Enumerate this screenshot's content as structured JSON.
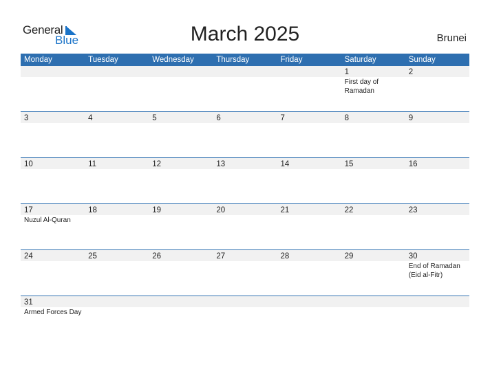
{
  "brand": {
    "line1": "General",
    "line2": "Blue"
  },
  "title": "March 2025",
  "country": "Brunei",
  "weekdays": [
    "Monday",
    "Tuesday",
    "Wednesday",
    "Thursday",
    "Friday",
    "Saturday",
    "Sunday"
  ],
  "weeks": [
    [
      {
        "day": "",
        "event": ""
      },
      {
        "day": "",
        "event": ""
      },
      {
        "day": "",
        "event": ""
      },
      {
        "day": "",
        "event": ""
      },
      {
        "day": "",
        "event": ""
      },
      {
        "day": "1",
        "event": "First day of Ramadan"
      },
      {
        "day": "2",
        "event": ""
      }
    ],
    [
      {
        "day": "3",
        "event": ""
      },
      {
        "day": "4",
        "event": ""
      },
      {
        "day": "5",
        "event": ""
      },
      {
        "day": "6",
        "event": ""
      },
      {
        "day": "7",
        "event": ""
      },
      {
        "day": "8",
        "event": ""
      },
      {
        "day": "9",
        "event": ""
      }
    ],
    [
      {
        "day": "10",
        "event": ""
      },
      {
        "day": "11",
        "event": ""
      },
      {
        "day": "12",
        "event": ""
      },
      {
        "day": "13",
        "event": ""
      },
      {
        "day": "14",
        "event": ""
      },
      {
        "day": "15",
        "event": ""
      },
      {
        "day": "16",
        "event": ""
      }
    ],
    [
      {
        "day": "17",
        "event": "Nuzul Al-Quran"
      },
      {
        "day": "18",
        "event": ""
      },
      {
        "day": "19",
        "event": ""
      },
      {
        "day": "20",
        "event": ""
      },
      {
        "day": "21",
        "event": ""
      },
      {
        "day": "22",
        "event": ""
      },
      {
        "day": "23",
        "event": ""
      }
    ],
    [
      {
        "day": "24",
        "event": ""
      },
      {
        "day": "25",
        "event": ""
      },
      {
        "day": "26",
        "event": ""
      },
      {
        "day": "27",
        "event": ""
      },
      {
        "day": "28",
        "event": ""
      },
      {
        "day": "29",
        "event": ""
      },
      {
        "day": "30",
        "event": "End of Ramadan (Eid al-Fitr)"
      }
    ],
    [
      {
        "day": "31",
        "event": "Armed Forces Day"
      },
      {
        "day": "",
        "event": ""
      },
      {
        "day": "",
        "event": ""
      },
      {
        "day": "",
        "event": ""
      },
      {
        "day": "",
        "event": ""
      },
      {
        "day": "",
        "event": ""
      },
      {
        "day": "",
        "event": ""
      }
    ]
  ]
}
